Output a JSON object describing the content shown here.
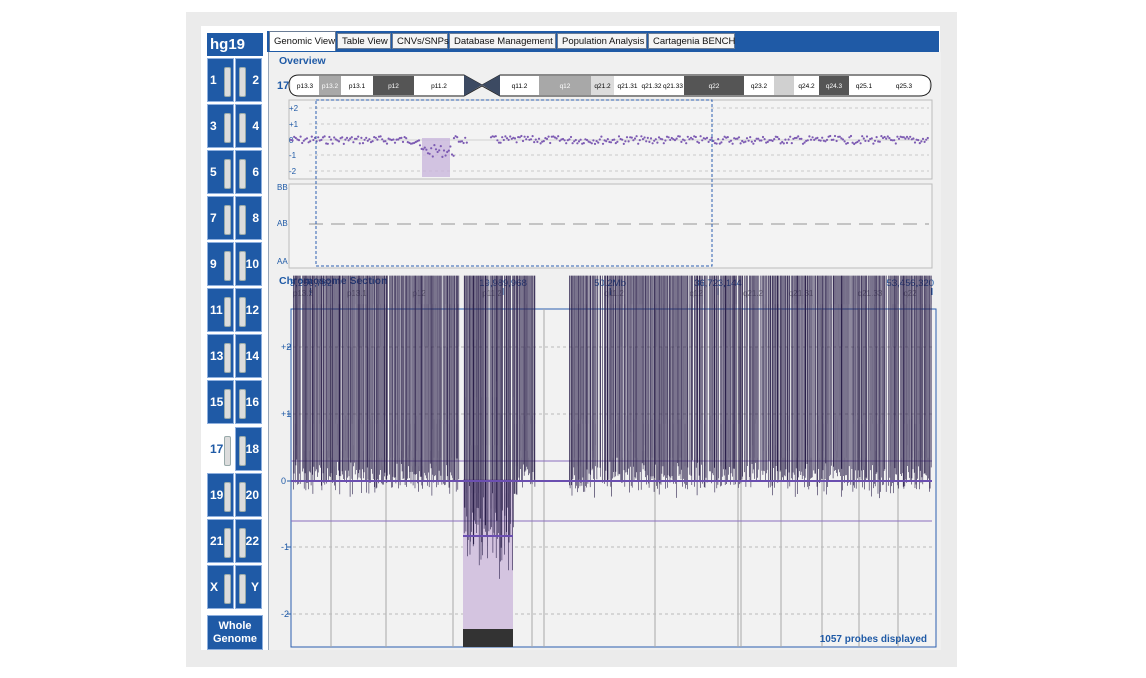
{
  "genome": "hg19",
  "chromosome_buttons": [
    [
      "1",
      "2"
    ],
    [
      "3",
      "4"
    ],
    [
      "5",
      "6"
    ],
    [
      "7",
      "8"
    ],
    [
      "9",
      "10"
    ],
    [
      "11",
      "12"
    ],
    [
      "13",
      "14"
    ],
    [
      "15",
      "16"
    ],
    [
      "17",
      "18"
    ],
    [
      "19",
      "20"
    ],
    [
      "21",
      "22"
    ],
    [
      "X",
      "Y"
    ]
  ],
  "active_chromosome": "17",
  "whole_genome_label": "Whole Genome",
  "tabs": [
    "Genomic View",
    "Table View",
    "CNVs/SNPs",
    "Database Management",
    "Population Analysis",
    "Cartagenia BENCH"
  ],
  "active_tab": "Genomic View",
  "overview": {
    "title": "Overview",
    "chromosome_label": "17",
    "bands": [
      "p13.3",
      "p13.2",
      "p13.1",
      "p12",
      "p11.2",
      "q11.2",
      "q12",
      "q21.2",
      "q21.31",
      "q21.32",
      "q21.33",
      "q22",
      "q23.2",
      "q24.2",
      "q24.3",
      "q25.1",
      "q25.3"
    ],
    "cn_ticks": [
      "+2",
      "+1",
      "0",
      "-1",
      "-2"
    ],
    "baf_ticks": [
      "BB",
      "AB",
      "AA"
    ]
  },
  "section": {
    "title": "Chromosome Section",
    "positions": [
      "3,256,792",
      "19,989,968",
      "50.2Mb",
      "36,723,144",
      "53,456,320"
    ],
    "bands": [
      "p13.2",
      "p13.1",
      "p12",
      "p11.2",
      "q11.2",
      "q12",
      "q21.2",
      "q21.31",
      "q21.33",
      "q22"
    ],
    "y_ticks": [
      "+2",
      "+1",
      "0",
      "-1",
      "-2"
    ],
    "probes_label": "1057 probes displayed"
  },
  "colors": {
    "brand_blue": "#1f5aa6",
    "probe_fill": "#7a62b4",
    "probe_outline": "#2a1f4a",
    "deletion_fill": "#d4c4e0",
    "overview_probe": "#7d5bb3"
  }
}
